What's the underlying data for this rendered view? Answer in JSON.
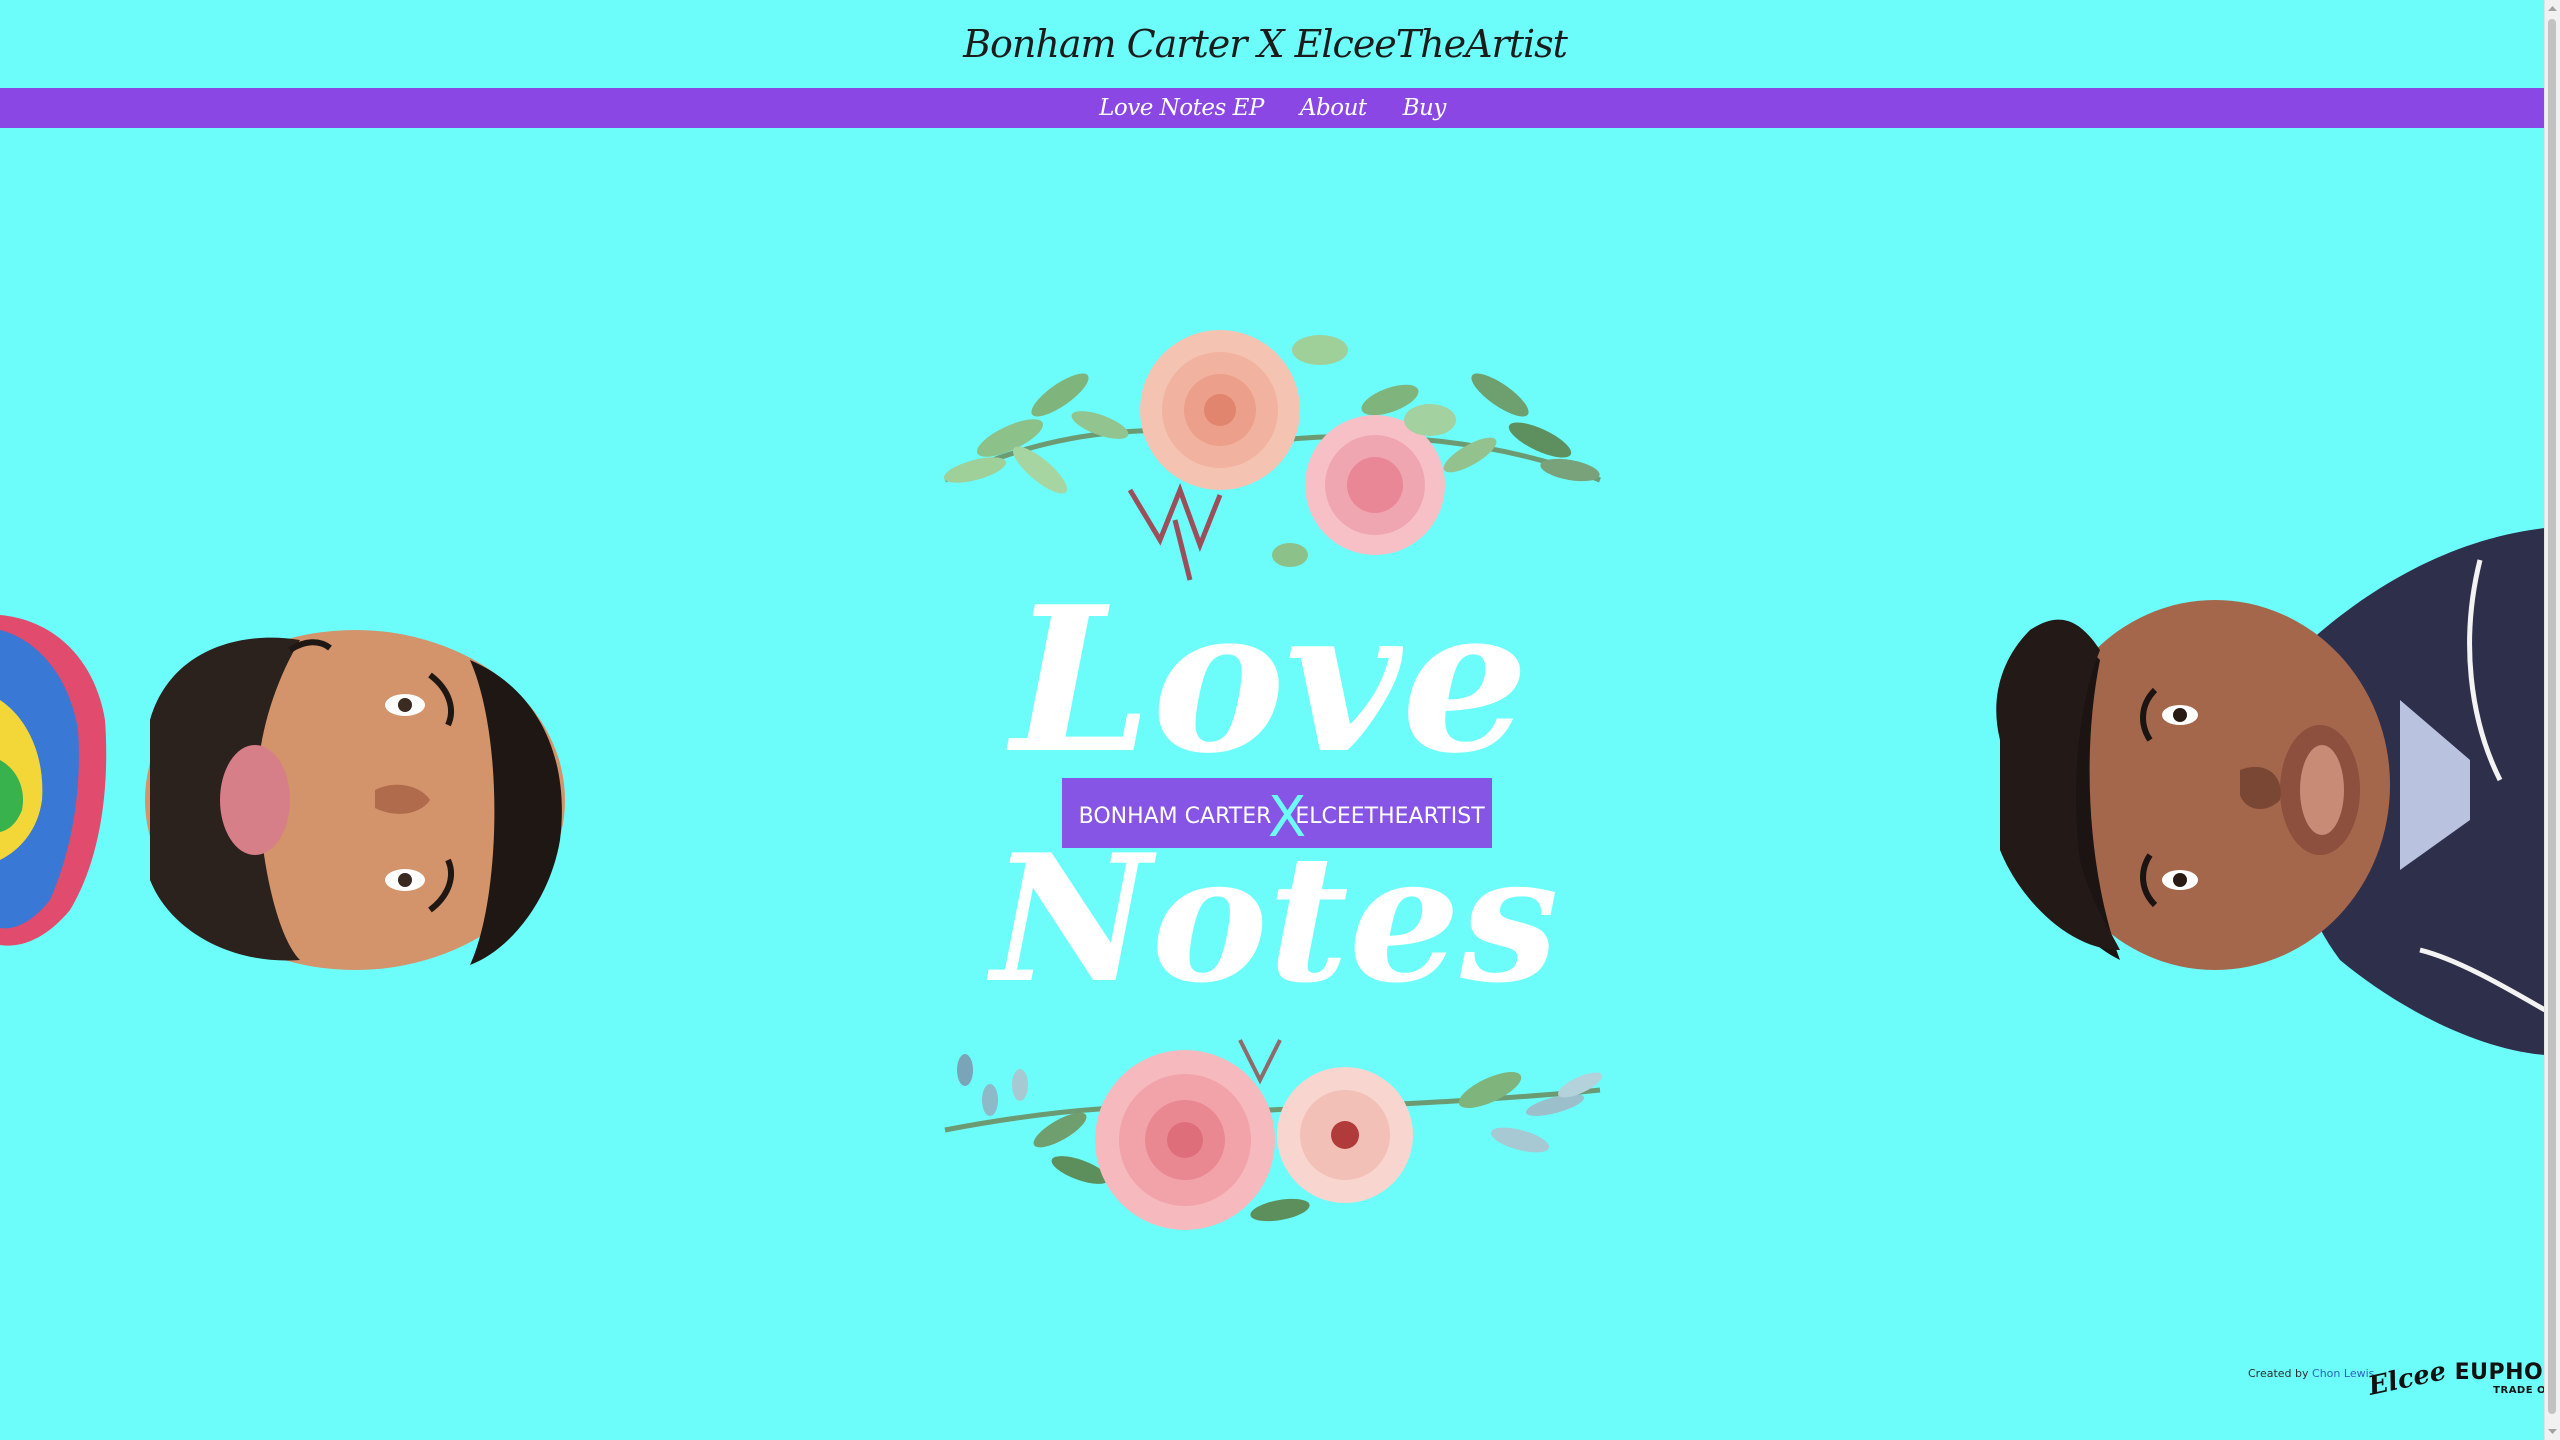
{
  "header": {
    "title": "Bonham Carter X ElceeTheArtist"
  },
  "nav": {
    "items": [
      "Love Notes EP",
      "About",
      "Buy"
    ]
  },
  "hero": {
    "title_top": "Love",
    "title_bottom": "Notes",
    "artist_left": "BONHAM CARTER",
    "connector": "X",
    "artist_right": "ELCEETHEARTIST"
  },
  "footer": {
    "credit_prefix": "Created by",
    "credit_name": "Chon Lewis",
    "logo_script": "Elcee",
    "logo_brand": "EUPHONY",
    "logo_brand_sub": "TRADE ORDER"
  },
  "colors": {
    "background": "#6cfdfb",
    "accent": "#8a47e4"
  }
}
